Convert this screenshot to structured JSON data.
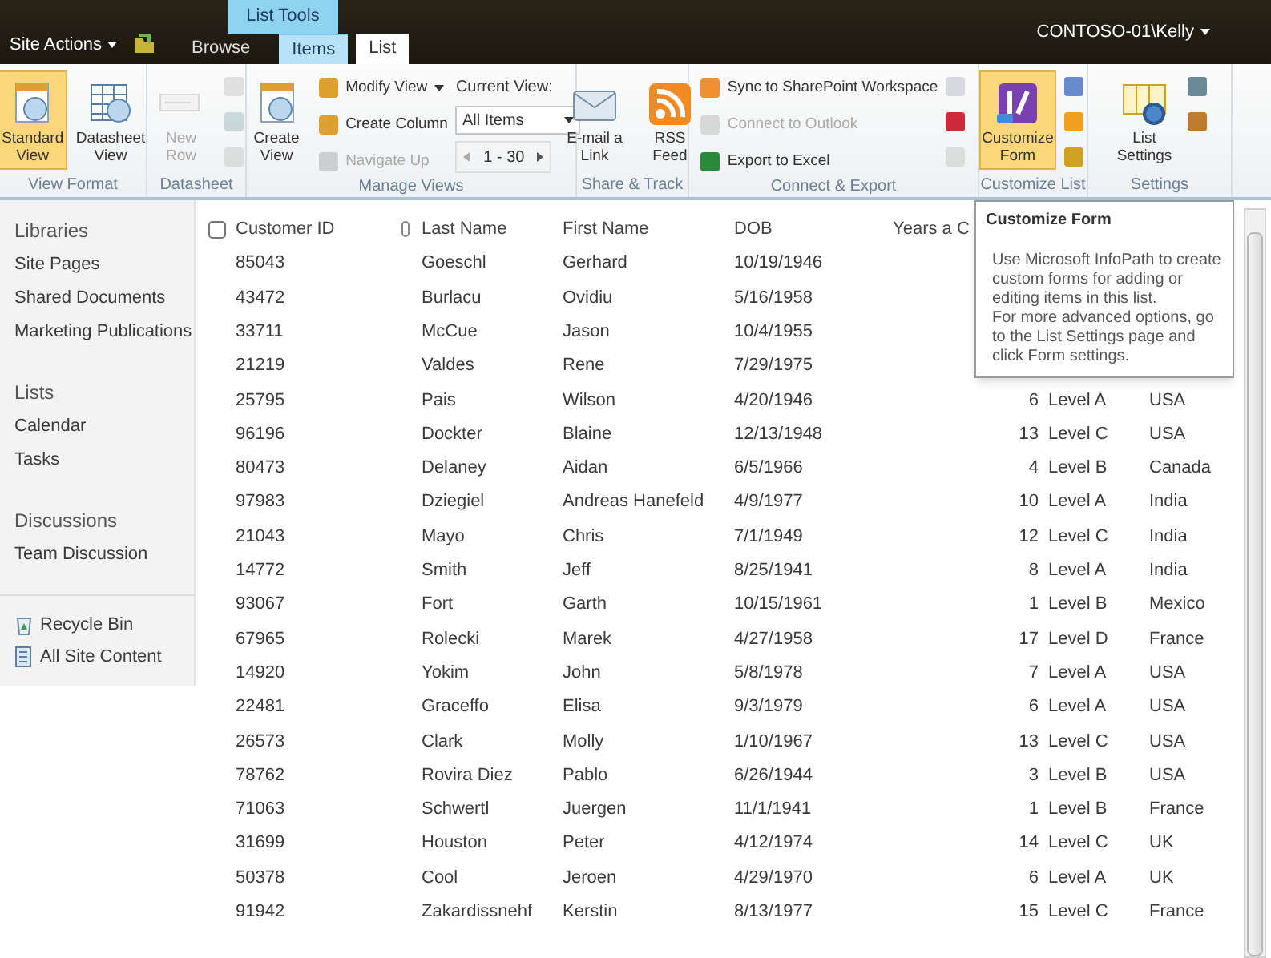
{
  "top_bar": {
    "site_actions": "Site Actions",
    "contextual_group": "List Tools",
    "tabs": [
      {
        "label": "Browse",
        "selected": false,
        "contextual": false
      },
      {
        "label": "Items",
        "selected": false,
        "contextual": true
      },
      {
        "label": "List",
        "selected": true,
        "contextual": true
      }
    ],
    "user": "CONTOSO-01\\Kelly"
  },
  "ribbon": {
    "groups": [
      {
        "label": "View Format",
        "columns": [
          {
            "kind": "large",
            "label": "Standard View",
            "highlighted": true,
            "disabled": false
          },
          {
            "kind": "large",
            "label": "Datasheet View",
            "highlighted": false,
            "disabled": false
          }
        ]
      },
      {
        "label": "Datasheet",
        "columns": [
          {
            "kind": "large",
            "label": "New Row",
            "highlighted": false,
            "disabled": true
          },
          {
            "kind": "icons",
            "items": [
              {
                "disabled": true
              },
              {
                "disabled": true
              },
              {
                "disabled": true
              }
            ]
          }
        ]
      },
      {
        "label": "Manage Views",
        "columns": [
          {
            "kind": "large",
            "label": "Create View",
            "highlighted": false,
            "disabled": false
          },
          {
            "kind": "stack",
            "items": [
              {
                "label": "Modify View",
                "dropdown": true,
                "disabled": false
              },
              {
                "label": "Create Column",
                "dropdown": false,
                "disabled": false
              },
              {
                "label": "Navigate Up",
                "dropdown": false,
                "disabled": true
              }
            ]
          },
          {
            "kind": "view-picker",
            "label": "Current View:",
            "value": "All Items",
            "pager": "1 - 30"
          }
        ]
      },
      {
        "label": "Share & Track",
        "columns": [
          {
            "kind": "large",
            "label": "E-mail a Link",
            "highlighted": false,
            "disabled": false
          },
          {
            "kind": "large",
            "label": "RSS Feed",
            "highlighted": false,
            "disabled": false
          }
        ]
      },
      {
        "label": "Connect & Export",
        "columns": [
          {
            "kind": "stack",
            "items": [
              {
                "label": "Sync to SharePoint Workspace",
                "dropdown": false,
                "disabled": false
              },
              {
                "label": "Connect to Outlook",
                "dropdown": false,
                "disabled": true
              },
              {
                "label": "Export to Excel",
                "dropdown": false,
                "disabled": false
              }
            ]
          },
          {
            "kind": "icons",
            "items": [
              {
                "disabled": true
              },
              {
                "disabled": false
              },
              {
                "disabled": true
              }
            ]
          }
        ]
      },
      {
        "label": "Customize List",
        "columns": [
          {
            "kind": "large",
            "label": "Customize Form",
            "highlighted": true,
            "disabled": false
          },
          {
            "kind": "icons",
            "items": [
              {
                "disabled": false
              },
              {
                "disabled": false
              },
              {
                "disabled": false
              }
            ]
          }
        ]
      },
      {
        "label": "Settings",
        "columns": [
          {
            "kind": "large",
            "label": "List Settings",
            "highlighted": false,
            "disabled": false
          },
          {
            "kind": "icons",
            "items": [
              {
                "disabled": false
              },
              {
                "disabled": false
              }
            ]
          }
        ]
      }
    ]
  },
  "nav": {
    "sections": [
      {
        "heading": "Libraries",
        "items": [
          "Site Pages",
          "Shared Documents",
          "Marketing Publications"
        ]
      },
      {
        "heading": "Lists",
        "items": [
          "Calendar",
          "Tasks"
        ]
      },
      {
        "heading": "Discussions",
        "items": [
          "Team Discussion"
        ]
      }
    ],
    "footer": [
      "Recycle Bin",
      "All Site Content"
    ]
  },
  "table": {
    "select_all_checked": false,
    "columns": [
      "Customer ID",
      "Last Name",
      "First Name",
      "DOB",
      "Years a C"
    ],
    "rows": [
      {
        "id": "85043",
        "last": "Goeschl",
        "first": "Gerhard",
        "dob": "10/19/1946"
      },
      {
        "id": "43472",
        "last": "Burlacu",
        "first": "Ovidiu",
        "dob": "5/16/1958"
      },
      {
        "id": "33711",
        "last": "McCue",
        "first": "Jason",
        "dob": "10/4/1955"
      },
      {
        "id": "21219",
        "last": "Valdes",
        "first": "Rene",
        "dob": "7/29/1975"
      },
      {
        "id": "25795",
        "last": "Pais",
        "first": "Wilson",
        "dob": "4/20/1946",
        "years": "6",
        "level": "Level A",
        "country": "USA"
      },
      {
        "id": "96196",
        "last": "Dockter",
        "first": "Blaine",
        "dob": "12/13/1948",
        "years": "13",
        "level": "Level C",
        "country": "USA"
      },
      {
        "id": "80473",
        "last": "Delaney",
        "first": "Aidan",
        "dob": "6/5/1966",
        "years": "4",
        "level": "Level B",
        "country": "Canada"
      },
      {
        "id": "97983",
        "last": "Dziegiel",
        "first": "Andreas Hanefeld",
        "dob": "4/9/1977",
        "years": "10",
        "level": "Level A",
        "country": "India"
      },
      {
        "id": "21043",
        "last": "Mayo",
        "first": "Chris",
        "dob": "7/1/1949",
        "years": "12",
        "level": "Level C",
        "country": "India"
      },
      {
        "id": "14772",
        "last": "Smith",
        "first": "Jeff",
        "dob": "8/25/1941",
        "years": "8",
        "level": "Level A",
        "country": "India"
      },
      {
        "id": "93067",
        "last": "Fort",
        "first": "Garth",
        "dob": "10/15/1961",
        "years": "1",
        "level": "Level B",
        "country": "Mexico"
      },
      {
        "id": "67965",
        "last": "Rolecki",
        "first": "Marek",
        "dob": "4/27/1958",
        "years": "17",
        "level": "Level D",
        "country": "France"
      },
      {
        "id": "14920",
        "last": "Yokim",
        "first": "John",
        "dob": "5/8/1978",
        "years": "7",
        "level": "Level A",
        "country": "USA"
      },
      {
        "id": "22481",
        "last": "Graceffo",
        "first": "Elisa",
        "dob": "9/3/1979",
        "years": "6",
        "level": "Level A",
        "country": "USA"
      },
      {
        "id": "26573",
        "last": "Clark",
        "first": "Molly",
        "dob": "1/10/1967",
        "years": "13",
        "level": "Level C",
        "country": "USA"
      },
      {
        "id": "78762",
        "last": "Rovira Diez",
        "first": "Pablo",
        "dob": "6/26/1944",
        "years": "3",
        "level": "Level B",
        "country": "USA"
      },
      {
        "id": "71063",
        "last": "Schwertl",
        "first": "Juergen",
        "dob": "11/1/1941",
        "years": "1",
        "level": "Level B",
        "country": "France"
      },
      {
        "id": "31699",
        "last": "Houston",
        "first": "Peter",
        "dob": "4/12/1974",
        "years": "14",
        "level": "Level C",
        "country": "UK"
      },
      {
        "id": "50378",
        "last": "Cool",
        "first": "Jeroen",
        "dob": "4/29/1970",
        "years": "6",
        "level": "Level A",
        "country": "UK"
      },
      {
        "id": "91942",
        "last": "Zakardissnehf",
        "first": "Kerstin",
        "dob": "8/13/1977",
        "years": "15",
        "level": "Level C",
        "country": "France"
      }
    ]
  },
  "tooltip": {
    "title": "Customize Form",
    "paragraphs": [
      "Use Microsoft InfoPath to create custom forms for adding or editing items in this list.",
      "For more advanced options, go to the List Settings page and click Form settings."
    ]
  }
}
